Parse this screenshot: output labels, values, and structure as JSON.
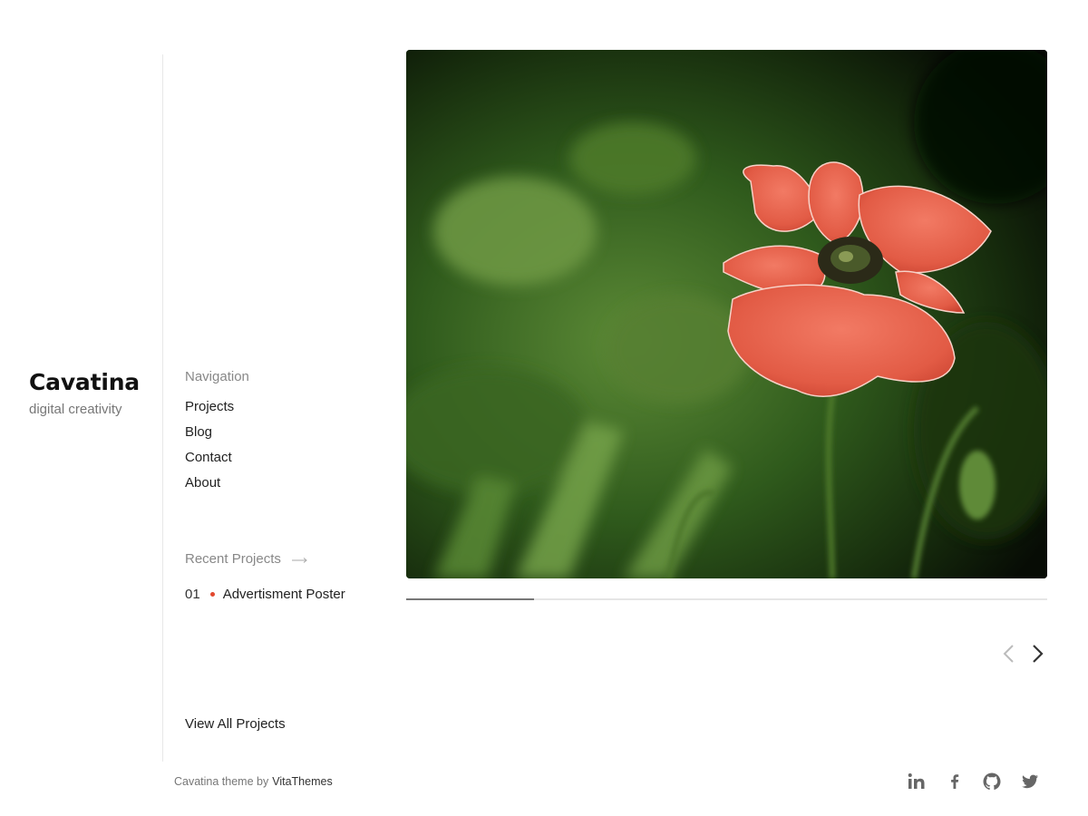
{
  "site": {
    "title": "Cavatina",
    "tagline": "digital creativity"
  },
  "navigation": {
    "heading": "Navigation",
    "items": [
      {
        "label": "Projects"
      },
      {
        "label": "Blog"
      },
      {
        "label": "Contact"
      },
      {
        "label": "About"
      }
    ]
  },
  "recent_projects": {
    "heading": "Recent Projects",
    "items": [
      {
        "number": "01",
        "title": "Advertisment Poster"
      }
    ],
    "view_all_label": "View All Projects"
  },
  "slider": {
    "image_subject": "red poppy flower",
    "progress": 0.2,
    "prev_icon": "chevron-left-icon",
    "next_icon": "chevron-right-icon"
  },
  "footer": {
    "credit_prefix": "Cavatina theme by",
    "credit_link": "VitaThemes",
    "social": [
      "linkedin-icon",
      "facebook-icon",
      "github-icon",
      "twitter-icon"
    ]
  },
  "colors": {
    "accent_dot": "#e2482f",
    "muted_text": "#888888"
  }
}
